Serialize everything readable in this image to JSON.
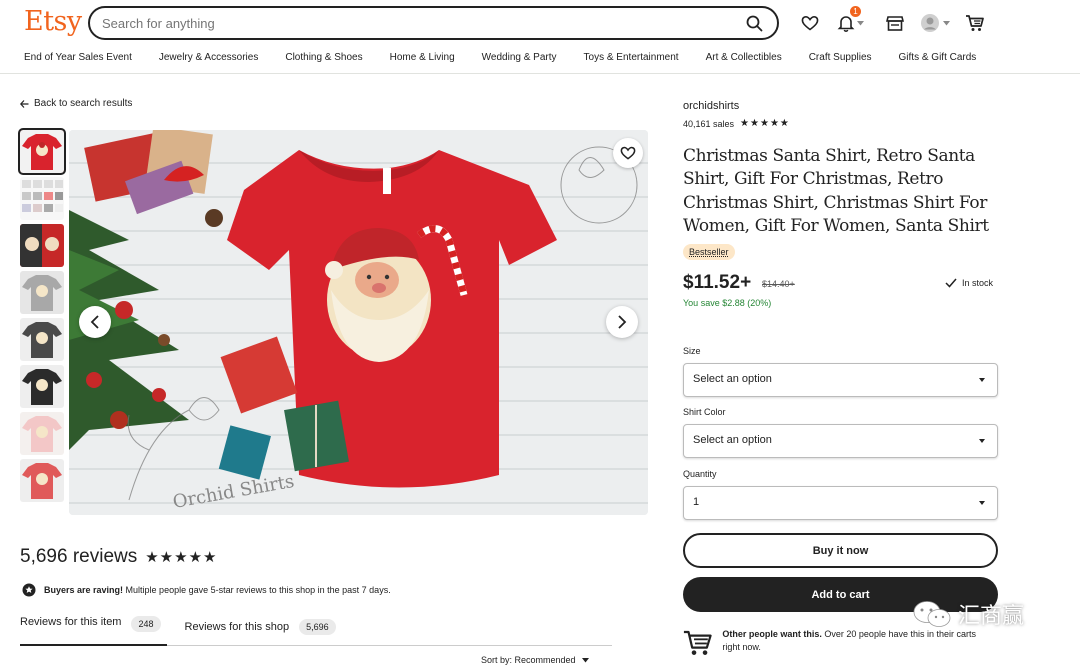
{
  "header": {
    "logo": "Etsy",
    "search_placeholder": "Search for anything",
    "cart_badge": "1",
    "nav": [
      "End of Year Sales Event",
      "Jewelry & Accessories",
      "Clothing & Shoes",
      "Home & Living",
      "Wedding & Party",
      "Toys & Entertainment",
      "Art & Collectibles",
      "Craft Supplies",
      "Gifts & Gift Cards"
    ]
  },
  "left": {
    "back_label": "Back to search results",
    "reviews_count": "5,696 reviews",
    "stars": "★★★★★",
    "raving_bold": "Buyers are raving!",
    "raving_text": " Multiple people gave 5-star reviews to this shop in the past 7 days.",
    "tabs": [
      {
        "label": "Reviews for this item",
        "count": "248"
      },
      {
        "label": "Reviews for this shop",
        "count": "5,696"
      }
    ],
    "sort_label": "Sort by: Recommended"
  },
  "product": {
    "shop_name": "orchidshirts",
    "sales": "40,161 sales",
    "stars": "★★★★★",
    "title": "Christmas Santa Shirt, Retro Santa Shirt, Gift For Christmas, Retro Christmas Shirt, Christmas Shirt For Women, Gift For Women, Santa Shirt",
    "badge": "Bestseller",
    "price": "$11.52+",
    "old_price": "$14.40+",
    "savings": "You save $2.88 (20%)",
    "stock": "In stock",
    "size_label": "Size",
    "size_value": "Select an option",
    "color_label": "Shirt Color",
    "color_value": "Select an option",
    "qty_label": "Quantity",
    "qty_value": "1",
    "buy_now": "Buy it now",
    "add_to_cart": "Add to cart",
    "others_bold": "Other people want this.",
    "others_text": " Over 20 people have this in their carts right now.",
    "image_watermark": "Orchid Shirts"
  },
  "overlay": {
    "watermark_text": "汇商赢"
  },
  "colors": {
    "brand": "#f1641e",
    "shirt": "#d9232d",
    "save_green": "#258635",
    "bestseller_bg": "#fde7c8"
  }
}
